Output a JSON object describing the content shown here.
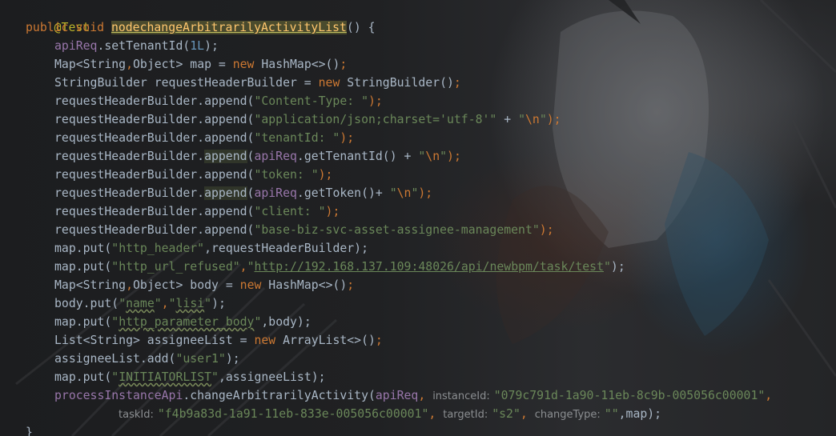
{
  "editor": {
    "language": "Java",
    "colors": {
      "background": "#1d1e20",
      "keyword": "#cc7832",
      "string": "#6a8759",
      "number": "#6897bb",
      "field": "#9876aa",
      "method_declaration": "#ffc66d",
      "annotation": "#bbb529",
      "default_text": "#a9b7c6"
    },
    "code": {
      "annotation": "@Test",
      "sig_public": "public",
      "sig_void": "void",
      "sig_method": "nodechangeArbitrarilyActivityList",
      "sig_rest": "() {",
      "l2_field": "apiReq",
      "l2_a": ".setTenantId(",
      "l2_num": "1L",
      "l2_b": ");",
      "l3_a": "Map<String",
      "l3_comma": ",",
      "l3_b": "Object> map = ",
      "l3_new": "new",
      "l3_c": " HashMap<>()",
      "l3_semi": ";",
      "l4_a": "StringBuilder requestHeaderBuilder = ",
      "l4_new": "new",
      "l4_b": " StringBuilder()",
      "l4_semi": ";",
      "rhb_append": "requestHeaderBuilder.append(",
      "rhb_prefix": "requestHeaderBuilder.",
      "append_word": "append",
      "paren_open": "(",
      "close_semi": ");",
      "plus": " + ",
      "l5_str": "\"Content-Type: \"",
      "l6_str": "\"application/json;charset='utf-8'\"",
      "str_newline_open": "\"",
      "newline_escape": "\\n",
      "str_newline_close": "\"",
      "l7_str": "\"tenantId: \"",
      "l8_field": "apiReq",
      "l8_call": ".getTenantId()",
      "l9_str": "\"token: \"",
      "l10_field": "apiReq",
      "l10_call": ".getToken()+ ",
      "l11_str": "\"client: \"",
      "l12_str": "\"base-biz-svc-asset-assignee-management\"",
      "l13_a": "map.put(",
      "l13_str": "\"http_header\"",
      "l13_b": ",requestHeaderBuilder);",
      "l14_a": "map.put(",
      "l14_str": "\"http_url_refused\"",
      "l14_comma": ",",
      "l14_q1": "\"",
      "l14_url": "http://192.168.137.109:48026/api/newbpm/task/test",
      "l14_q2": "\"",
      "l14_end": ");",
      "l15_a": "Map<String",
      "l15_comma": ",",
      "l15_b": "Object> body = ",
      "l15_new": "new",
      "l15_c": " HashMap<>()",
      "l15_semi": ";",
      "l16_a": "body.put(",
      "l16_q1": "\"",
      "l16_name": "name",
      "l16_q2": "\"",
      "l16_comma": ",",
      "l16_q3": "\"",
      "l16_lisi": "lisi",
      "l16_q4": "\"",
      "l16_end": ");",
      "l17_a": "map.put(",
      "l17_q1": "\"",
      "l17_key": "http_parameter_body",
      "l17_q2": "\"",
      "l17_b": ",body);",
      "l18_a": "List<String> assigneeList = ",
      "l18_new": "new",
      "l18_b": " ArrayList<>()",
      "l18_semi": ";",
      "l19_a": "assigneeList.add(",
      "l19_str": "\"user1\"",
      "l19_b": ");",
      "l20_a": "map.put(",
      "l20_q1": "\"",
      "l20_key": "INITIATORLIST",
      "l20_q2": "\"",
      "l20_b": ",assigneeList);",
      "l21_field1": "processInstanceApi",
      "l21_call": ".changeArbitrarilyActivity(",
      "l21_field2": "apiReq",
      "l21_comma1": ",",
      "hint_instance": "instanceId:",
      "l21_instance": "\"079c791d-1a90-11eb-8c9b-005056c00001\"",
      "l21_comma2": ",",
      "hint_task": "taskId:",
      "l22_task": "\"f4b9a83d-1a91-11eb-833e-005056c00001\"",
      "l22_comma1": ",",
      "hint_target": "targetId:",
      "l22_target": "\"s2\"",
      "l22_comma2": ",",
      "hint_change": "changeType:",
      "l22_change": "\"\"",
      "l22_end": ",map);",
      "closing_brace": "}"
    }
  }
}
